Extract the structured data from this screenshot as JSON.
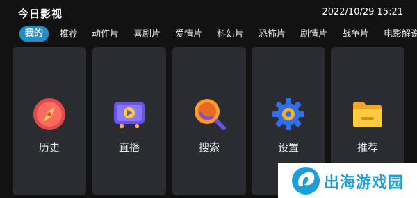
{
  "header": {
    "app_title": "今日影视",
    "datetime": "2022/10/29 15:21"
  },
  "tabs": [
    {
      "label": "我的",
      "active": true
    },
    {
      "label": "推荐"
    },
    {
      "label": "动作片"
    },
    {
      "label": "喜剧片"
    },
    {
      "label": "爱情片"
    },
    {
      "label": "科幻片"
    },
    {
      "label": "恐怖片"
    },
    {
      "label": "剧情片"
    },
    {
      "label": "战争片"
    },
    {
      "label": "电影解说"
    }
  ],
  "cards": [
    {
      "label": "历史",
      "icon": "compass-icon"
    },
    {
      "label": "直播",
      "icon": "tv-play-icon"
    },
    {
      "label": "搜索",
      "icon": "search-icon"
    },
    {
      "label": "设置",
      "icon": "gear-icon"
    },
    {
      "label": "推荐",
      "icon": "folder-icon"
    }
  ],
  "watermark": {
    "text": "出海游戏园"
  },
  "colors": {
    "background": "#121212",
    "card": "#2a2c31",
    "accent": "#1e8fc9",
    "watermark_text": "#1b9ed9"
  }
}
